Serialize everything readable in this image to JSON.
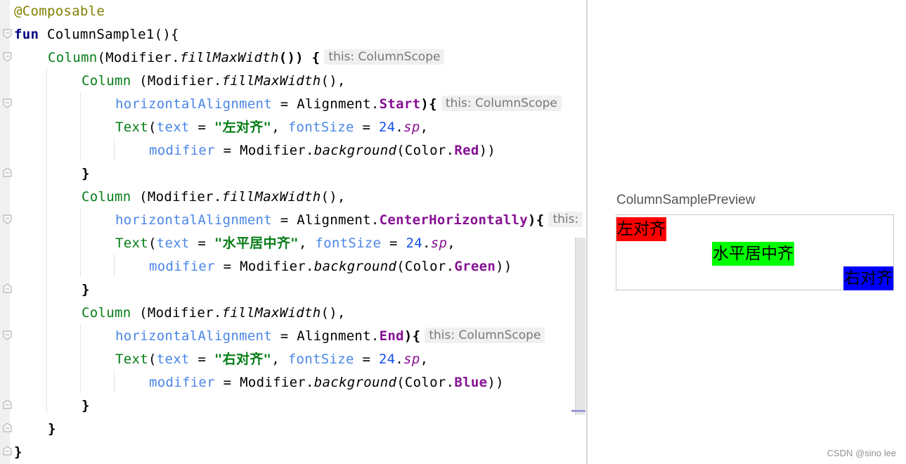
{
  "editor": {
    "lines": [
      {
        "annotation": "@Composable"
      },
      {
        "keyword": "fun",
        "name": "ColumnSample1",
        "rest": "(){"
      },
      {
        "col": "Column",
        "open": "(Modifier.",
        "fn": "fillMaxWidth",
        "close": "()) {",
        "hint": "this: ColumnScope"
      },
      {
        "col": "Column",
        "open": " (Modifier.",
        "fn": "fillMaxWidth",
        "close": "(),"
      },
      {
        "param": "horizontalAlignment",
        "eq": " = Alignment.",
        "prop": "Start",
        "close": "){",
        "hint": "this: ColumnScope"
      },
      {
        "text": "Text",
        "p1": "text",
        "eq1": " = ",
        "str": "\"左对齐\"",
        "sep": ", ",
        "p2": "fontSize",
        "eq2": " = ",
        "num": "24",
        "dot": ".",
        "ext": "sp",
        "end": ","
      },
      {
        "param": "modifier",
        "eq": " = Modifier.",
        "fn": "background",
        "mid": "(Color.",
        "prop": "Red",
        "close": "))"
      },
      {
        "brace": "}"
      },
      {
        "col": "Column",
        "open": " (Modifier.",
        "fn": "fillMaxWidth",
        "close": "(),"
      },
      {
        "param": "horizontalAlignment",
        "eq": " = Alignment.",
        "prop": "CenterHorizontally",
        "close": "){",
        "hint": "this:"
      },
      {
        "text": "Text",
        "p1": "text",
        "eq1": " = ",
        "str": "\"水平居中齐\"",
        "sep": ", ",
        "p2": "fontSize",
        "eq2": " = ",
        "num": "24",
        "dot": ".",
        "ext": "sp",
        "end": ","
      },
      {
        "param": "modifier",
        "eq": " = Modifier.",
        "fn": "background",
        "mid": "(Color.",
        "prop": "Green",
        "close": "))"
      },
      {
        "brace": "}"
      },
      {
        "col": "Column",
        "open": " (Modifier.",
        "fn": "fillMaxWidth",
        "close": "(),"
      },
      {
        "param": "horizontalAlignment",
        "eq": " = Alignment.",
        "prop": "End",
        "close": "){",
        "hint": "this: ColumnScope"
      },
      {
        "text": "Text",
        "p1": "text",
        "eq1": " = ",
        "str": "\"右对齐\"",
        "sep": ", ",
        "p2": "fontSize",
        "eq2": " = ",
        "num": "24",
        "dot": ".",
        "ext": "sp",
        "end": ","
      },
      {
        "param": "modifier",
        "eq": " = Modifier.",
        "fn": "background",
        "mid": "(Color.",
        "prop": "Blue",
        "close": "))"
      },
      {
        "brace": "}"
      },
      {
        "brace": "}"
      },
      {
        "brace": "}"
      }
    ]
  },
  "preview": {
    "title": "ColumnSamplePreview",
    "items": [
      {
        "label": "左对齐",
        "color": "#ff0000",
        "align": "start"
      },
      {
        "label": "水平居中齐",
        "color": "#00ff00",
        "align": "center"
      },
      {
        "label": "右对齐",
        "color": "#0000ff",
        "align": "end"
      }
    ]
  },
  "watermark": "CSDN @sino lee"
}
